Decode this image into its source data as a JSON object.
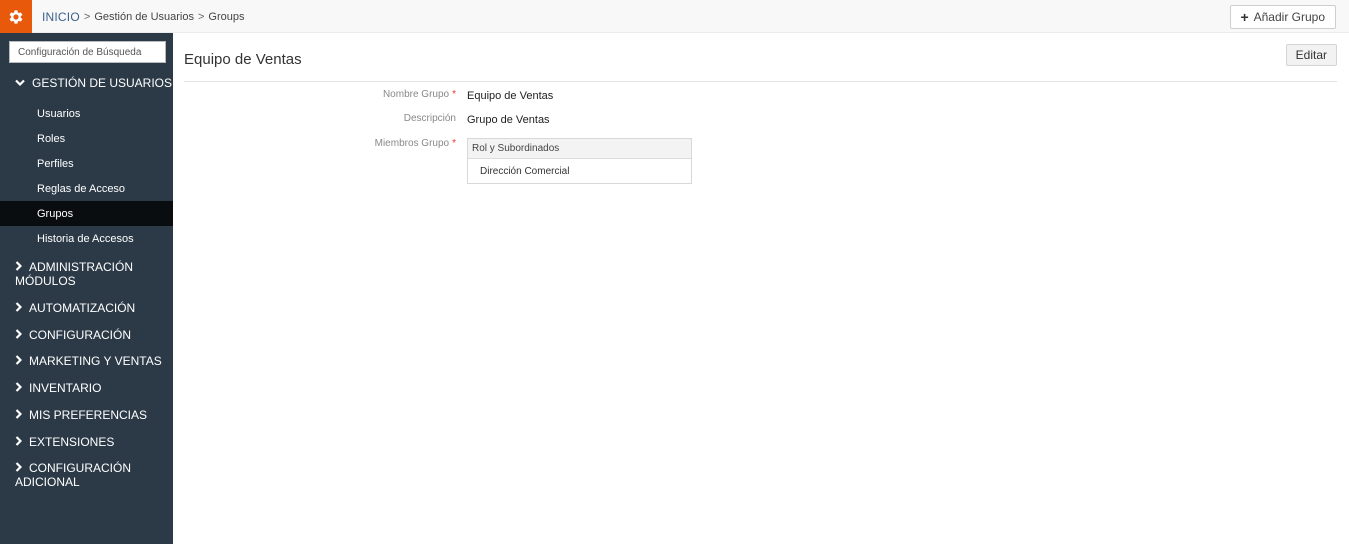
{
  "topbar": {
    "home": "INICIO",
    "sep": ">",
    "crumb1": "Gestión de Usuarios",
    "crumb2": "Groups",
    "add_group": "Añadir Grupo"
  },
  "sidebar": {
    "search_placeholder": "Configuración de Búsqueda",
    "open_section": "GESTIÓN DE USUARIOS",
    "sub_items": [
      "Usuarios",
      "Roles",
      "Perfiles",
      "Reglas de Acceso",
      "Grupos",
      "Historia de Accesos"
    ],
    "active_sub_item": "Grupos",
    "sections": [
      {
        "line1": "ADMINISTRACIÓN",
        "line2": "MÓDULOS"
      },
      {
        "line1": "AUTOMATIZACIÓN",
        "line2": ""
      },
      {
        "line1": "CONFIGURACIÓN",
        "line2": ""
      },
      {
        "line1": "MARKETING Y VENTAS",
        "line2": ""
      },
      {
        "line1": "INVENTARIO",
        "line2": ""
      },
      {
        "line1": "MIS PREFERENCIAS",
        "line2": ""
      },
      {
        "line1": "EXTENSIONES",
        "line2": ""
      },
      {
        "line1": "CONFIGURACIÓN",
        "line2": "ADICIONAL"
      }
    ]
  },
  "main": {
    "title": "Equipo de Ventas",
    "edit": "Editar",
    "fields": {
      "name_label": "Nombre Grupo",
      "name_value": "Equipo de Ventas",
      "desc_label": "Descripción",
      "desc_value": "Grupo de Ventas",
      "members_label": "Miembros Grupo",
      "required_mark": "*"
    },
    "members": {
      "header": "Rol y Subordinados",
      "items": [
        "Dirección Comercial"
      ]
    }
  },
  "colors": {
    "accent": "#e8590c",
    "sidebar_bg": "#2c3a47",
    "sidebar_active": "#0a0d10",
    "link": "#3a5f8a"
  }
}
